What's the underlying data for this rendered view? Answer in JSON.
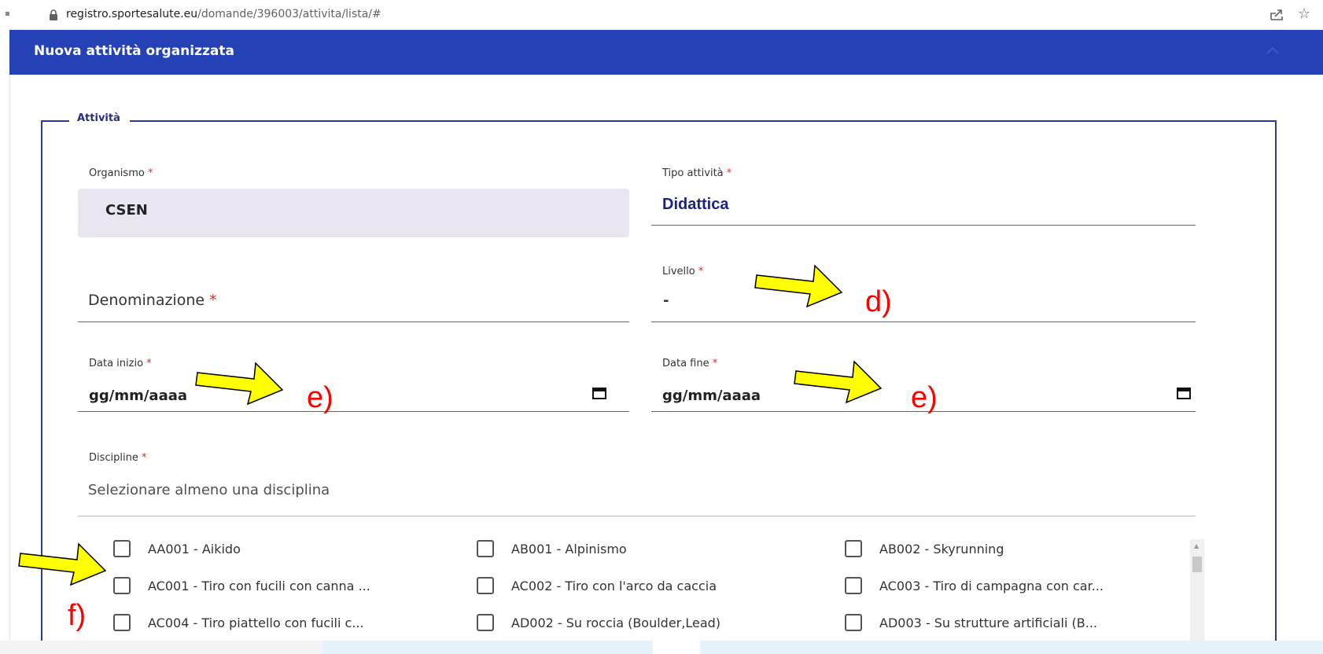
{
  "browser": {
    "url_host": "registro.sportesalute.eu",
    "url_path": "/domande/396003/attivita/lista/#"
  },
  "header": {
    "title": "Nuova attività organizzata",
    "bg_color": "#2441b5"
  },
  "section": {
    "legend": "Attività"
  },
  "form": {
    "organismo": {
      "label": "Organismo",
      "required_mark": "*",
      "value": "CSEN"
    },
    "tipo_attivita": {
      "label": "Tipo attività",
      "required_mark": "*",
      "value": "Didattica"
    },
    "denominazione": {
      "label": "Denominazione",
      "required_mark": "*"
    },
    "livello": {
      "label": "Livello",
      "required_mark": "*",
      "value": "-"
    },
    "data_inizio": {
      "label": "Data inizio",
      "required_mark": "*",
      "value": "gg/mm/aaaa"
    },
    "data_fine": {
      "label": "Data fine",
      "required_mark": "*",
      "value": "gg/mm/aaaa"
    },
    "discipline": {
      "label": "Discipline",
      "required_mark": "*",
      "placeholder": "Selezionare almeno una disciplina"
    }
  },
  "disciplines": [
    "AA001 - Aikido",
    "AB001 - Alpinismo",
    "AB002 - Skyrunning",
    "AC001 - Tiro con fucili con canna ...",
    "AC002 - Tiro con l'arco da caccia",
    "AC003 - Tiro di campagna con car...",
    "AC004 - Tiro piattello con fucili c...",
    "AD002 - Su roccia (Boulder,Lead)",
    "AD003 - Su strutture artificiali (B..."
  ],
  "annotations": {
    "d": "d)",
    "e1": "e)",
    "e2": "e)",
    "f": "f)",
    "arrow_color": "#ffff00",
    "text_color": "#ff0000"
  }
}
